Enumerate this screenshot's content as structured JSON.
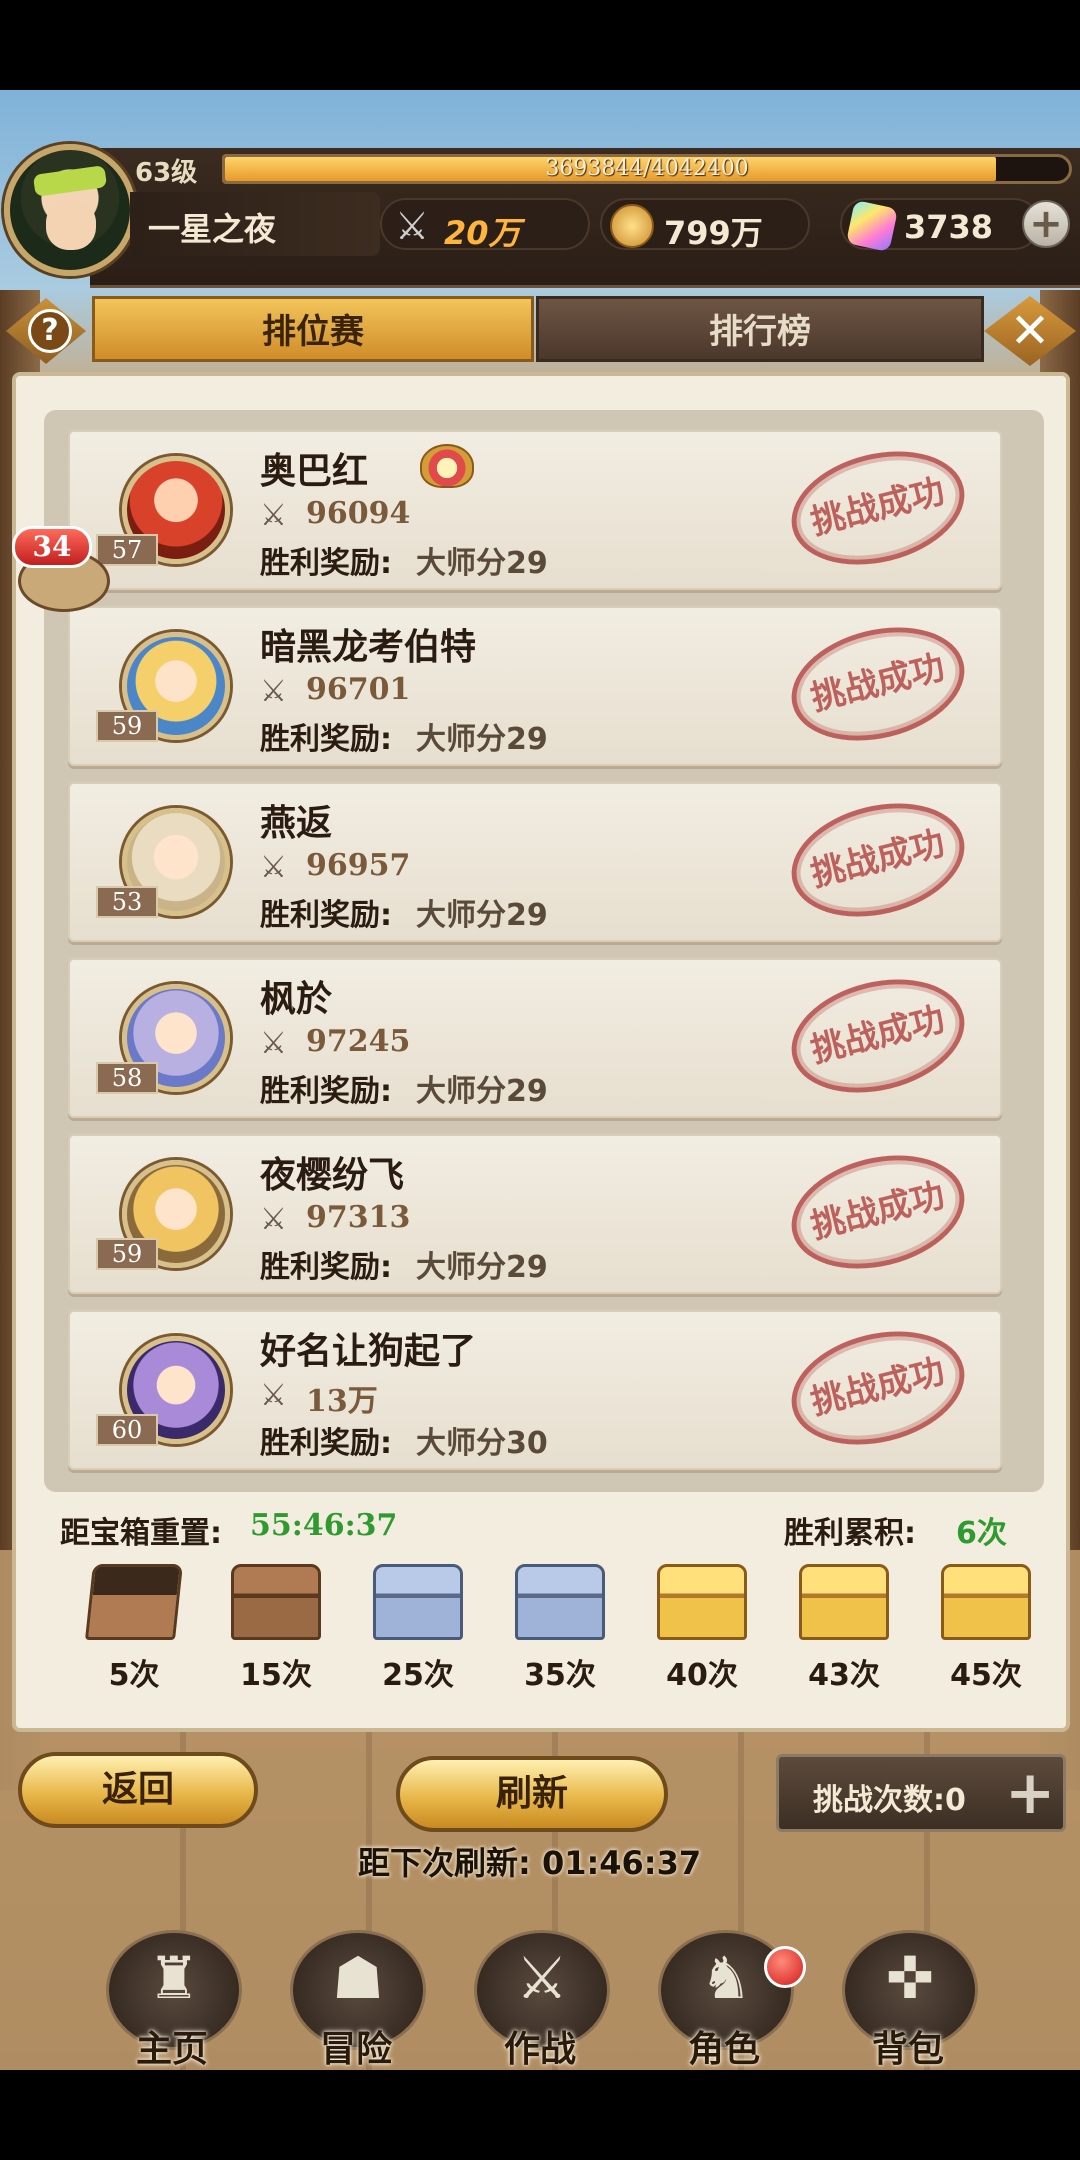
{
  "player": {
    "level": "63级",
    "name": "一星之夜",
    "exp_text": "3693844/4042400",
    "exp_ratio": 0.914
  },
  "resources": {
    "power": "20万",
    "gold": "799万",
    "gems": "3738"
  },
  "tabs": {
    "ranked": "排位赛",
    "leaderboard": "排行榜"
  },
  "chat_badge": "34",
  "reward_label": "胜利奖励:",
  "stamp_text": "挑战成功",
  "opponents": [
    {
      "name": "奥巴红",
      "level": "57",
      "power": "96094",
      "reward": "大师分29"
    },
    {
      "name": "暗黑龙考伯特",
      "level": "59",
      "power": "96701",
      "reward": "大师分29"
    },
    {
      "name": "燕返",
      "level": "53",
      "power": "96957",
      "reward": "大师分29"
    },
    {
      "name": "枫於",
      "level": "58",
      "power": "97245",
      "reward": "大师分29"
    },
    {
      "name": "夜樱纷飞",
      "level": "59",
      "power": "97313",
      "reward": "大师分29"
    },
    {
      "name": "好名让狗起了",
      "level": "60",
      "power": "13万",
      "reward": "大师分30"
    }
  ],
  "chest": {
    "reset_label": "距宝箱重置:",
    "reset_time": "55:46:37",
    "wins_label": "胜利累积:",
    "wins_value": "6次",
    "milestones": [
      "5次",
      "15次",
      "25次",
      "35次",
      "40次",
      "43次",
      "45次"
    ]
  },
  "buttons": {
    "back": "返回",
    "refresh": "刷新",
    "challenges": "挑战次数:0"
  },
  "next_refresh": "距下次刷新: 01:46:37",
  "nav": {
    "home": "主页",
    "adventure": "冒险",
    "battle": "作战",
    "character": "角色",
    "bag": "背包"
  },
  "colors": {
    "accent_gold": "#e8b84a",
    "success_green": "#2f9a2f",
    "stamp_red": "#b54a48"
  }
}
